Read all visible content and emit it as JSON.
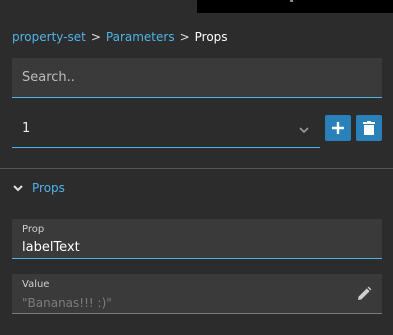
{
  "breadcrumb": {
    "items": [
      "property-set",
      "Parameters"
    ],
    "separator": ">",
    "current": "Props"
  },
  "search": {
    "placeholder": "Search.."
  },
  "selector": {
    "value": "1",
    "icon": "chevron-down-icon"
  },
  "actions": {
    "add_icon": "plus-icon",
    "delete_icon": "trash-icon"
  },
  "section": {
    "title": "Props",
    "icon": "chevron-down-icon"
  },
  "prop_field": {
    "label": "Prop",
    "value": "labelText"
  },
  "value_field": {
    "label": "Value",
    "value": "\"Bananas!!! :)\"",
    "icon": "pencil-icon"
  },
  "colors": {
    "accent": "#4fb3e8",
    "button": "#2a80b9",
    "background": "#2c2c2c",
    "field": "#3a3a3a"
  }
}
